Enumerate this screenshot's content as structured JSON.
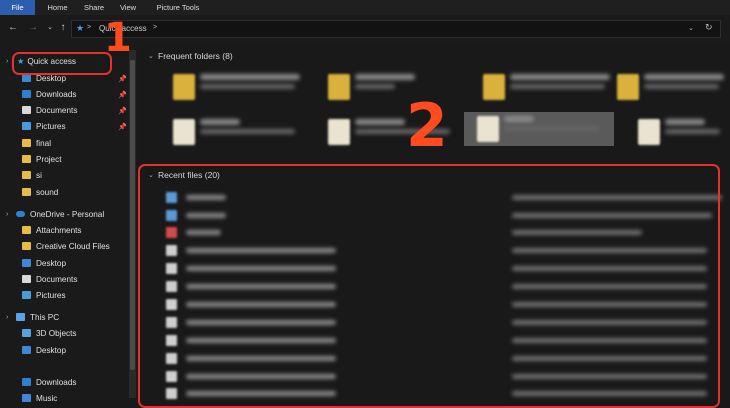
{
  "ribbon": {
    "tabs": [
      "File",
      "Home",
      "Share",
      "View",
      "Picture Tools"
    ]
  },
  "address": {
    "path": "Quick access",
    "separator": ">"
  },
  "sidebar": {
    "quick_access": "Quick access",
    "items": [
      "Desktop",
      "Downloads",
      "Documents",
      "Pictures",
      "final",
      "Project",
      "si",
      "sound"
    ],
    "onedrive": "OneDrive - Personal",
    "onedrive_items": [
      "Attachments",
      "Creative Cloud Files",
      "Desktop",
      "Documents",
      "Pictures"
    ],
    "this_pc": "This PC",
    "pc_items": [
      "3D Objects",
      "Desktop",
      "Downloads",
      "Music"
    ]
  },
  "main": {
    "frequent_header": "Frequent folders (8)",
    "recent_header": "Recent files (20)"
  },
  "annotations": {
    "one": "1",
    "two": "2"
  },
  "colors": {
    "annotation": "#e4322a",
    "accent": "#2b5fae"
  }
}
